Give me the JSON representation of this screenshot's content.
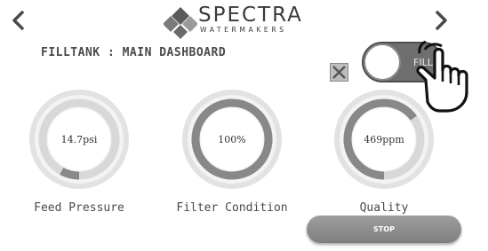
{
  "logo": {
    "word": "SPECTRA",
    "sub": "WATERMAKERS"
  },
  "page_title": "FILLTANK : MAIN DASHBOARD",
  "gauges": [
    {
      "value": "14.7psi",
      "label": "Feed Pressure",
      "fill": 0.08
    },
    {
      "value": "100%",
      "label": "Filter Condition",
      "fill": 1.0
    },
    {
      "value": "469ppm",
      "label": "Quality",
      "fill": 0.65
    }
  ],
  "toggle": {
    "text": "FILL"
  },
  "stop_button": {
    "label": "STOP"
  },
  "icons": {
    "prev": "chevron-left-icon",
    "next": "chevron-right-icon",
    "close": "close-box-icon",
    "pointer": "pointing-hand-icon"
  },
  "colors": {
    "ring_outer": "#e6e6e6",
    "ring_track": "#d6d6d6",
    "ring_fill": "#888888",
    "button": "#8a8a8a",
    "text": "#4a4a4a"
  }
}
